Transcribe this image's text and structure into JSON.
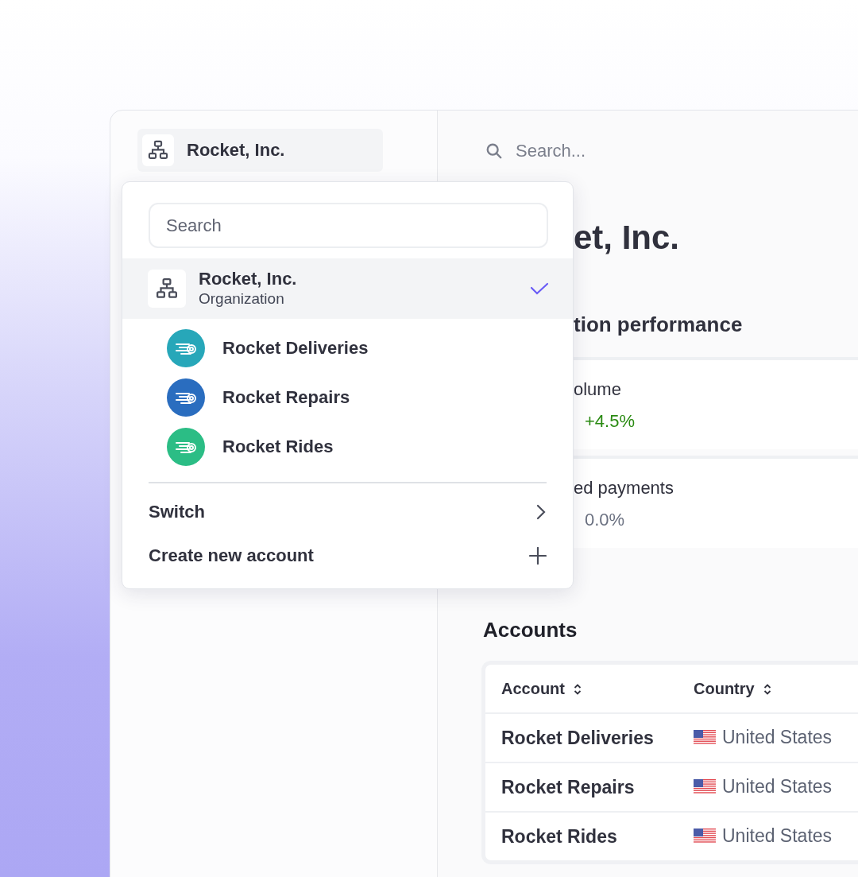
{
  "org_switcher": {
    "label": "Rocket, Inc."
  },
  "search": {
    "placeholder": "Search..."
  },
  "dropdown": {
    "search": {
      "placeholder": "Search"
    },
    "organization": {
      "name": "Rocket, Inc.",
      "type": "Organization",
      "selected": true
    },
    "accounts": [
      {
        "name": "Rocket Deliveries",
        "color": "#27a7b9"
      },
      {
        "name": "Rocket Repairs",
        "color": "#2a6dbf"
      },
      {
        "name": "Rocket Rides",
        "color": "#2bbd85"
      }
    ],
    "actions": [
      {
        "label": "Switch",
        "kind": "submenu"
      },
      {
        "label": "Create new account",
        "kind": "create"
      }
    ]
  },
  "main": {
    "title": "et, Inc.",
    "section_title": "tion performance",
    "metrics": [
      {
        "label": "olume",
        "change": "+4.5%",
        "color": "#2a8a12"
      },
      {
        "label": "ed payments",
        "change": "0.0%",
        "color": "#6a7080"
      }
    ]
  },
  "accounts_section": {
    "title": "Accounts",
    "table": {
      "columns": [
        "Account",
        "Country"
      ],
      "rows": [
        {
          "account": "Rocket Deliveries",
          "country": "United States"
        },
        {
          "account": "Rocket Repairs",
          "country": "United States"
        },
        {
          "account": "Rocket Rides",
          "country": "United States"
        }
      ]
    }
  }
}
